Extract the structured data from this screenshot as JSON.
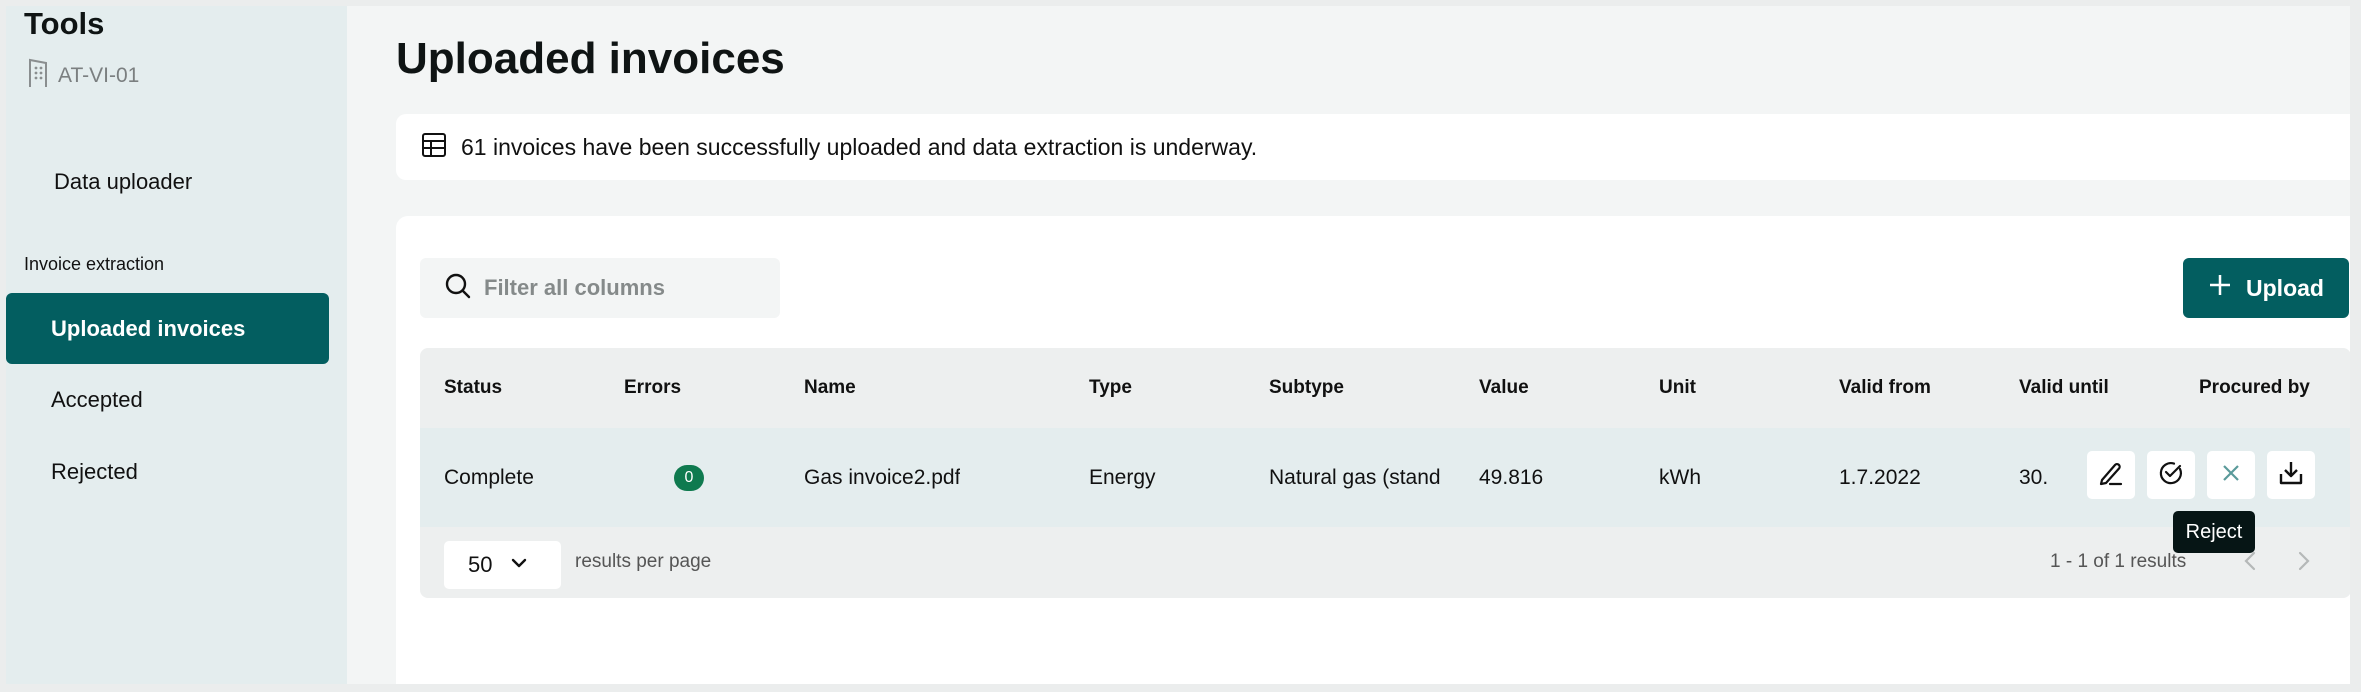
{
  "sidebar": {
    "title": "Tools",
    "site": {
      "icon": "building-icon",
      "label": "AT-VI-01"
    },
    "top_items": [
      {
        "label": "Data uploader"
      }
    ],
    "section_label": "Invoice extraction",
    "items": [
      {
        "label": "Uploaded invoices",
        "active": true
      },
      {
        "label": "Accepted",
        "active": false
      },
      {
        "label": "Rejected",
        "active": false
      }
    ]
  },
  "main": {
    "title": "Uploaded invoices",
    "banner": {
      "icon": "table-icon",
      "text": "61 invoices have been successfully uploaded and data extraction is underway."
    },
    "search": {
      "icon": "search-icon",
      "placeholder": "Filter all columns",
      "value": ""
    },
    "upload_button": {
      "icon": "plus-icon",
      "label": "Upload"
    },
    "table": {
      "columns": [
        "Status",
        "Errors",
        "Name",
        "Type",
        "Subtype",
        "Value",
        "Unit",
        "Valid from",
        "Valid until",
        "Procured by"
      ],
      "rows": [
        {
          "status": "Complete",
          "errors": "0",
          "name": "Gas invoice2.pdf",
          "type": "Energy",
          "subtype": "Natural gas (stand",
          "value": "49.816",
          "unit": "kWh",
          "valid_from": "1.7.2022",
          "valid_until": "30.",
          "actions": [
            {
              "icon": "pencil-icon",
              "label": "Edit"
            },
            {
              "icon": "check-circle-icon",
              "label": "Accept"
            },
            {
              "icon": "close-icon",
              "label": "Reject"
            },
            {
              "icon": "download-icon",
              "label": "Download"
            }
          ]
        }
      ]
    },
    "tooltip": "Reject",
    "pagination": {
      "per_page_value": "50",
      "per_page_label": "results per page",
      "results_label": "1 -  1 of  1 results"
    }
  },
  "colors": {
    "brand": "#035e60",
    "badge": "#0f7a4f",
    "tooltip_bg": "#061515",
    "reject_icon": "#5a9a9a"
  }
}
